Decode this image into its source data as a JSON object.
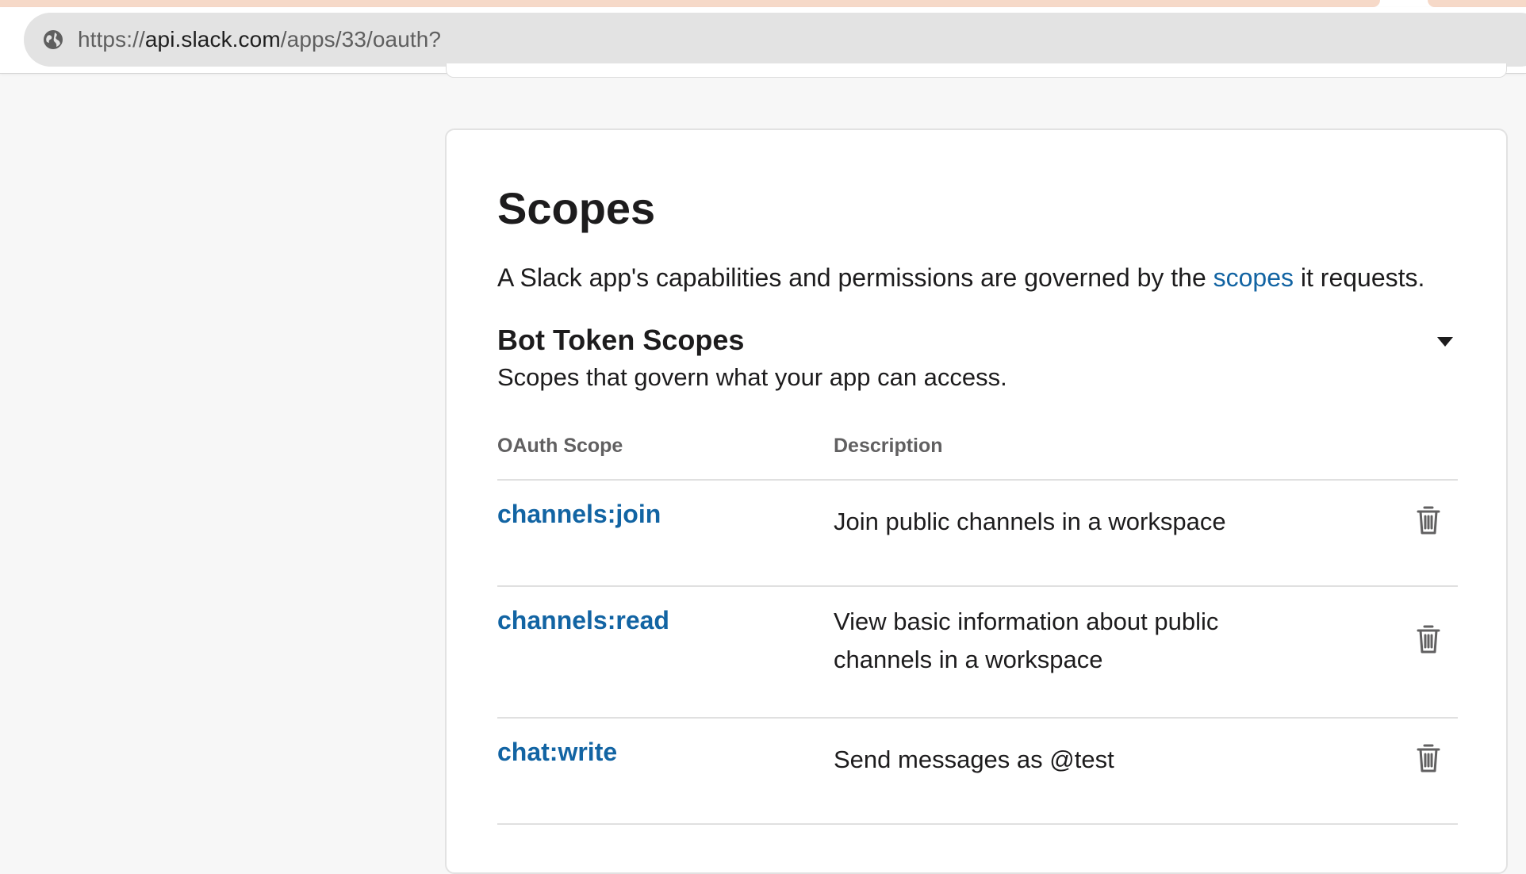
{
  "browser": {
    "url_scheme": "https://",
    "url_host": "api.slack.com",
    "url_path": "/apps/33/oauth?"
  },
  "scopes_section": {
    "title": "Scopes",
    "description_before": "A Slack app's capabilities and permissions are governed by the ",
    "description_link": "scopes",
    "description_after": " it requests."
  },
  "bot_token_scopes": {
    "title": "Bot Token Scopes",
    "description": "Scopes that govern what your app can access.",
    "columns": [
      "OAuth Scope",
      "Description"
    ],
    "rows": [
      {
        "scope": "channels:join",
        "description": "Join public channels in a workspace"
      },
      {
        "scope": "channels:read",
        "description": "View basic information about public channels in a workspace"
      },
      {
        "scope": "chat:write",
        "description": "Send messages as @test"
      }
    ]
  },
  "icons": {
    "site": "globe-icon",
    "toggle": "caret-down-icon",
    "remove": "trash-icon"
  },
  "colors": {
    "link": "#1264a3",
    "text": "#1d1c1d",
    "muted": "#616061",
    "background": "#f7f7f7",
    "tab_accent": "#f6d9c8"
  }
}
